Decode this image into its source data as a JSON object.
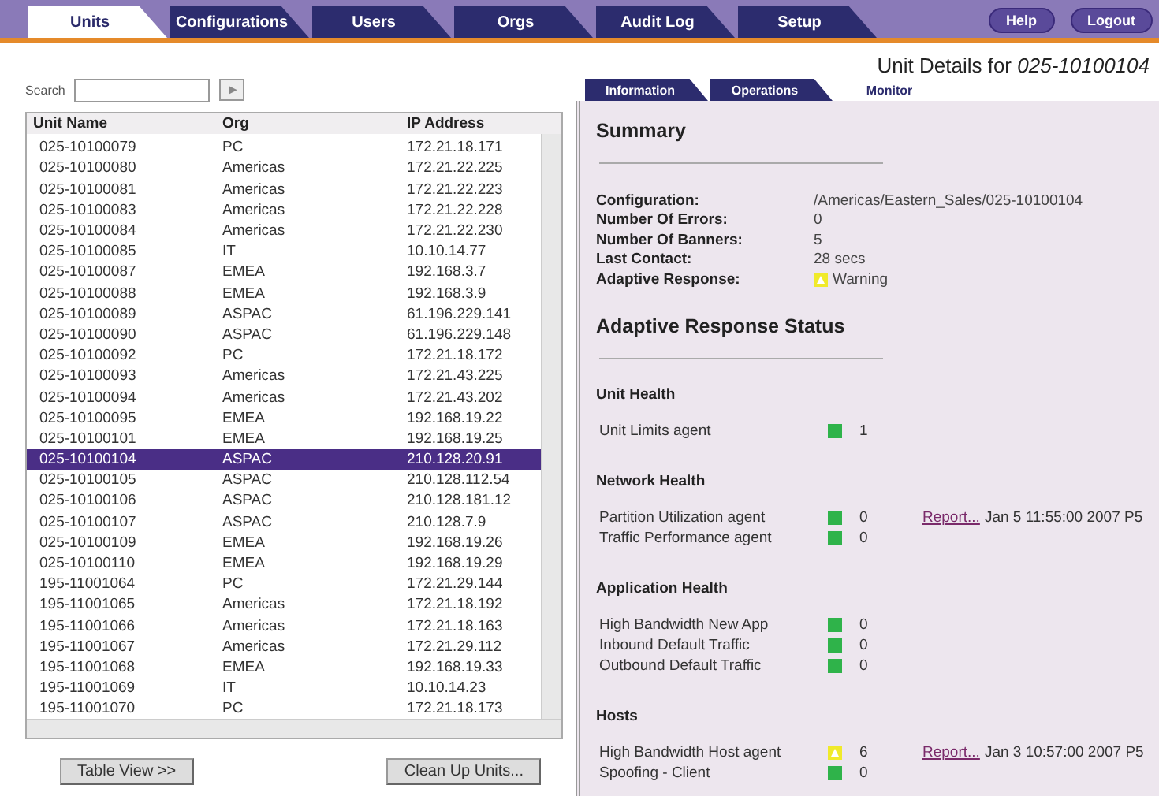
{
  "tabs": [
    {
      "label": "Units",
      "selected": true
    },
    {
      "label": "Configurations",
      "selected": false
    },
    {
      "label": "Users",
      "selected": false
    },
    {
      "label": "Orgs",
      "selected": false
    },
    {
      "label": "Audit Log",
      "selected": false
    },
    {
      "label": "Setup",
      "selected": false
    }
  ],
  "top_buttons": [
    "Help",
    "Logout"
  ],
  "search": {
    "label": "Search",
    "button": "▶"
  },
  "table": {
    "columns": [
      "Unit Name",
      "Org",
      "IP Address"
    ],
    "rows": [
      {
        "cells": [
          "025-10100079",
          "PC",
          "172.21.18.171"
        ],
        "selected": false
      },
      {
        "cells": [
          "025-10100080",
          "Americas",
          "172.21.22.225"
        ],
        "selected": false
      },
      {
        "cells": [
          "025-10100081",
          "Americas",
          "172.21.22.223"
        ],
        "selected": false
      },
      {
        "cells": [
          "025-10100083",
          "Americas",
          "172.21.22.228"
        ],
        "selected": false
      },
      {
        "cells": [
          "025-10100084",
          "Americas",
          "172.21.22.230"
        ],
        "selected": false
      },
      {
        "cells": [
          "025-10100085",
          "IT",
          "10.10.14.77"
        ],
        "selected": false
      },
      {
        "cells": [
          "025-10100087",
          "EMEA",
          "192.168.3.7"
        ],
        "selected": false
      },
      {
        "cells": [
          "025-10100088",
          "EMEA",
          "192.168.3.9"
        ],
        "selected": false
      },
      {
        "cells": [
          "025-10100089",
          "ASPAC",
          "61.196.229.141"
        ],
        "selected": false
      },
      {
        "cells": [
          "025-10100090",
          "ASPAC",
          "61.196.229.148"
        ],
        "selected": false
      },
      {
        "cells": [
          "025-10100092",
          "PC",
          "172.21.18.172"
        ],
        "selected": false
      },
      {
        "cells": [
          "025-10100093",
          "Americas",
          "172.21.43.225"
        ],
        "selected": false
      },
      {
        "cells": [
          "025-10100094",
          "Americas",
          "172.21.43.202"
        ],
        "selected": false
      },
      {
        "cells": [
          "025-10100095",
          "EMEA",
          "192.168.19.22"
        ],
        "selected": false
      },
      {
        "cells": [
          "025-10100101",
          "EMEA",
          "192.168.19.25"
        ],
        "selected": false
      },
      {
        "cells": [
          "025-10100104",
          "ASPAC",
          "210.128.20.91"
        ],
        "selected": true
      },
      {
        "cells": [
          "025-10100105",
          "ASPAC",
          "210.128.112.54"
        ],
        "selected": false
      },
      {
        "cells": [
          "025-10100106",
          "ASPAC",
          "210.128.181.12"
        ],
        "selected": false
      },
      {
        "cells": [
          "025-10100107",
          "ASPAC",
          "210.128.7.9"
        ],
        "selected": false
      },
      {
        "cells": [
          "025-10100109",
          "EMEA",
          "192.168.19.26"
        ],
        "selected": false
      },
      {
        "cells": [
          "025-10100110",
          "EMEA",
          "192.168.19.29"
        ],
        "selected": false
      },
      {
        "cells": [
          "195-11001064",
          "PC",
          "172.21.29.144"
        ],
        "selected": false
      },
      {
        "cells": [
          "195-11001065",
          "Americas",
          "172.21.18.192"
        ],
        "selected": false
      },
      {
        "cells": [
          "195-11001066",
          "Americas",
          "172.21.18.163"
        ],
        "selected": false
      },
      {
        "cells": [
          "195-11001067",
          "Americas",
          "172.21.29.112"
        ],
        "selected": false
      },
      {
        "cells": [
          "195-11001068",
          "EMEA",
          "192.168.19.33"
        ],
        "selected": false
      },
      {
        "cells": [
          "195-11001069",
          "IT",
          "10.10.14.23"
        ],
        "selected": false
      },
      {
        "cells": [
          "195-11001070",
          "PC",
          "172.21.18.173"
        ],
        "selected": false
      }
    ]
  },
  "bottom_buttons": [
    "Table View >>",
    "Clean Up Units..."
  ],
  "details": {
    "title_prefix": "Unit Details for ",
    "unit": "025-10100104",
    "tabs": [
      {
        "label": "Information",
        "selected": false
      },
      {
        "label": "Operations",
        "selected": false
      },
      {
        "label": "Monitor",
        "selected": true
      }
    ],
    "summary_title": "Summary",
    "summary": [
      {
        "label": "Configuration:",
        "value": "/Americas/Eastern_Sales/025-10100104"
      },
      {
        "label": "Number Of Errors:",
        "value": "0"
      },
      {
        "label": "Number Of Banners:",
        "value": "5"
      },
      {
        "label": "Last Contact:",
        "value": "28 secs"
      },
      {
        "label": "Adaptive Response:",
        "value": "Warning",
        "kind": "warning",
        "color": "#f0ea2a"
      }
    ],
    "status_title": "Adaptive Response Status",
    "groups": [
      {
        "title": "Unit Health",
        "agents": [
          {
            "name": "Unit Limits agent",
            "kind": "ok",
            "color": "#2fb34a",
            "count": "1"
          }
        ]
      },
      {
        "title": "Network Health",
        "agents": [
          {
            "name": "Partition Utilization agent",
            "kind": "ok",
            "color": "#2fb34a",
            "count": "0",
            "link": "Report...",
            "date": "Jan 5 11:55:00 2007 P5"
          },
          {
            "name": "Traffic Performance agent",
            "kind": "ok",
            "color": "#2fb34a",
            "count": "0"
          }
        ]
      },
      {
        "title": "Application Health",
        "agents": [
          {
            "name": "High Bandwidth New App",
            "kind": "ok",
            "color": "#2fb34a",
            "count": "0"
          },
          {
            "name": "Inbound Default Traffic",
            "kind": "ok",
            "color": "#2fb34a",
            "count": "0"
          },
          {
            "name": "Outbound Default Traffic",
            "kind": "ok",
            "color": "#2fb34a",
            "count": "0"
          }
        ]
      },
      {
        "title": "Hosts",
        "agents": [
          {
            "name": "High Bandwidth Host agent",
            "kind": "warning",
            "color": "#f0ea2a",
            "count": "6",
            "link": "Report...",
            "date": "Jan 3 10:57:00 2007 P5"
          },
          {
            "name": "Spoofing - Client",
            "kind": "ok",
            "color": "#2fb34a",
            "count": "0"
          }
        ]
      }
    ]
  }
}
